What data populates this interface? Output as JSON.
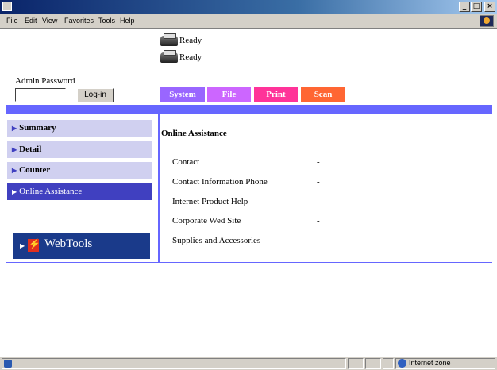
{
  "menu": {
    "items": [
      {
        "label": "File"
      },
      {
        "label": "Edit"
      },
      {
        "label": "View"
      },
      {
        "label": "Favorites"
      },
      {
        "label": "Tools"
      },
      {
        "label": "Help"
      }
    ]
  },
  "title_buttons": {
    "minimize": "_",
    "maximize": "□",
    "close": "×"
  },
  "device_status": [
    {
      "icon": "printer-icon",
      "text": "Ready"
    },
    {
      "icon": "scanner-icon",
      "text": "Ready"
    }
  ],
  "admin": {
    "label": "Admin Password",
    "password_value": "",
    "login_label": "Log-in"
  },
  "tabs": [
    {
      "label": "System",
      "color": "#9966ff"
    },
    {
      "label": "File",
      "color": "#cc66ff"
    },
    {
      "label": "Print",
      "color": "#ff3399"
    },
    {
      "label": "Scan",
      "color": "#ff6633"
    }
  ],
  "sidebar": {
    "items": [
      {
        "label": "Summary",
        "active": false
      },
      {
        "label": "Detail",
        "active": false
      },
      {
        "label": "Counter",
        "active": false
      },
      {
        "label": "Online Assistance",
        "active": true
      }
    ],
    "webtools_label": "WebTools"
  },
  "content": {
    "title": "Online Assistance",
    "rows": [
      {
        "label": "Contact",
        "value": "-"
      },
      {
        "label": "Contact Information Phone",
        "value": "-"
      },
      {
        "label": "Internet Product Help",
        "value": "-"
      },
      {
        "label": "Corporate Wed Site",
        "value": "-"
      },
      {
        "label": "Supplies and Accessories",
        "value": "-"
      }
    ]
  },
  "statusbar": {
    "zone_label": "Internet zone"
  },
  "colors": {
    "accent_blue": "#6666ff",
    "active_nav": "#4040c0",
    "nav_bg": "#d0d0f0",
    "webtools_bg": "#1a3a8a"
  }
}
